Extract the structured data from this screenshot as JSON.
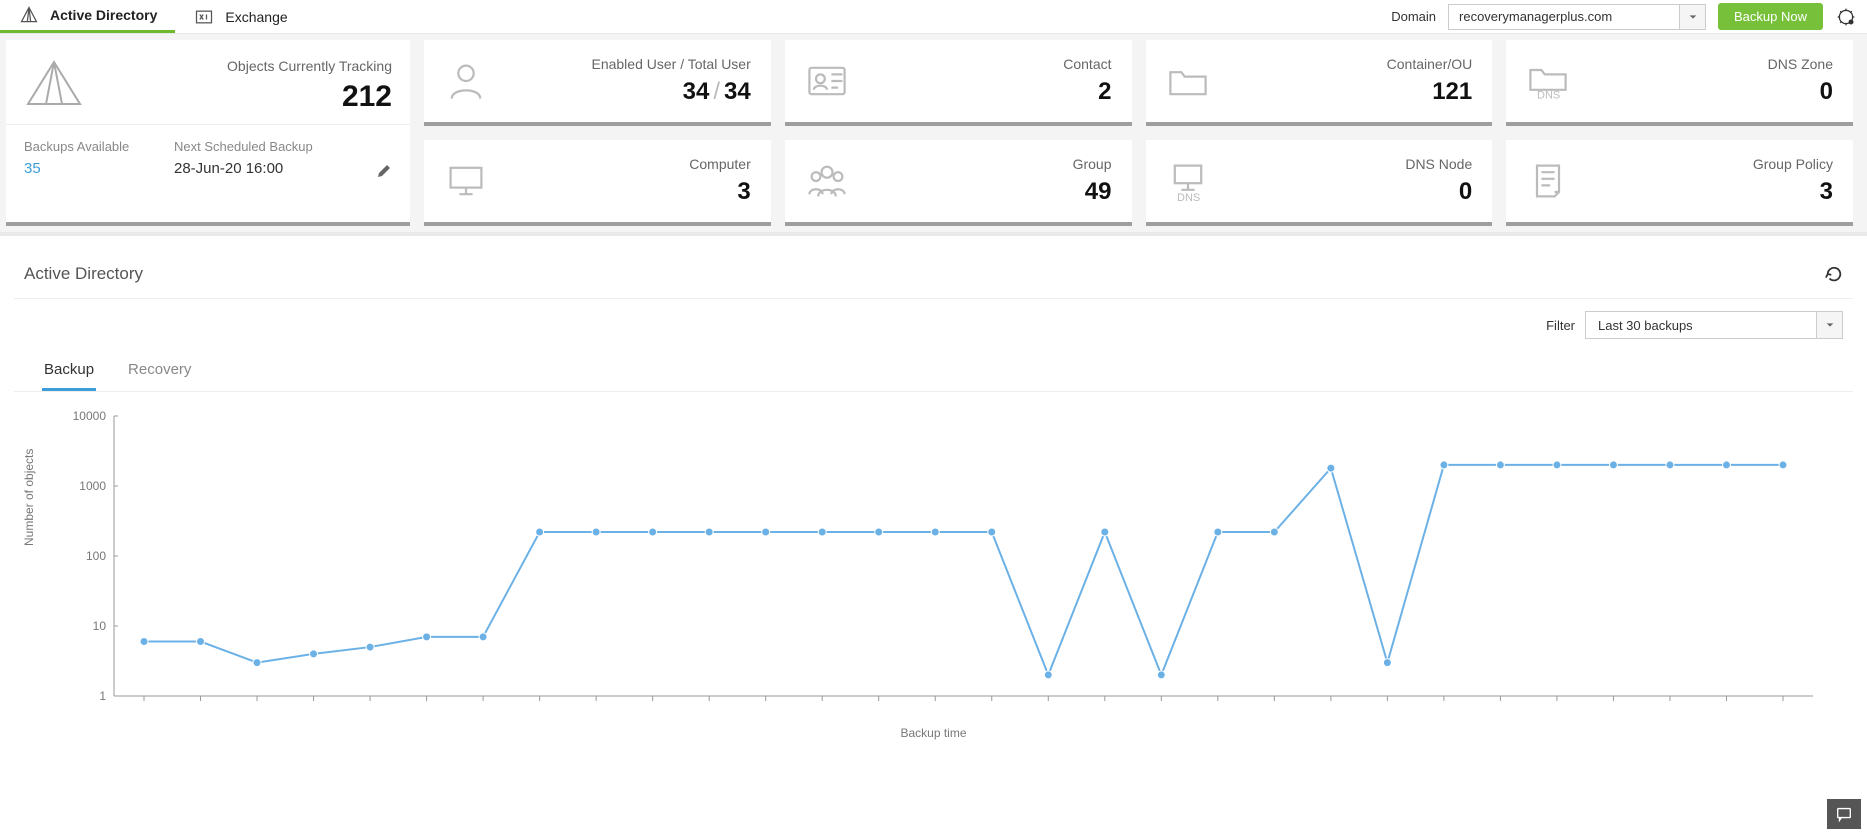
{
  "nav": {
    "tab1": "Active Directory",
    "tab2": "Exchange",
    "domain_label": "Domain",
    "domain_value": "recoverymanagerplus.com",
    "backup_button": "Backup Now"
  },
  "tracking": {
    "label": "Objects Currently Tracking",
    "value": "212",
    "backups_available_label": "Backups Available",
    "backups_available_value": "35",
    "next_label": "Next Scheduled Backup",
    "next_value": "28-Jun-20 16:00"
  },
  "stats": {
    "enabled_user_label": "Enabled User / Total User",
    "enabled_user_a": "34",
    "enabled_user_b": "34",
    "contact_label": "Contact",
    "contact_value": "2",
    "container_label": "Container/OU",
    "container_value": "121",
    "dnszone_label": "DNS Zone",
    "dnszone_value": "0",
    "computer_label": "Computer",
    "computer_value": "3",
    "group_label": "Group",
    "group_value": "49",
    "dnsnode_label": "DNS Node",
    "dnsnode_value": "0",
    "gpo_label": "Group Policy",
    "gpo_value": "3"
  },
  "panel": {
    "title": "Active Directory",
    "filter_label": "Filter",
    "filter_value": "Last 30 backups",
    "tab_backup": "Backup",
    "tab_recovery": "Recovery",
    "ylabel": "Number of objects",
    "xlabel": "Backup time"
  },
  "chart_data": {
    "type": "line",
    "xlabel": "Backup time",
    "ylabel": "Number of objects",
    "yscale": "log",
    "ylim": [
      1,
      10000
    ],
    "yticks": [
      1,
      10,
      100,
      1000,
      10000
    ],
    "series": [
      {
        "name": "Backup",
        "values": [
          6,
          6,
          3,
          4,
          5,
          7,
          7,
          220,
          220,
          220,
          220,
          220,
          220,
          220,
          220,
          220,
          2,
          220,
          2,
          220,
          220,
          1800,
          3,
          2000,
          2000,
          2000,
          2000,
          2000,
          2000,
          2000
        ]
      }
    ]
  }
}
